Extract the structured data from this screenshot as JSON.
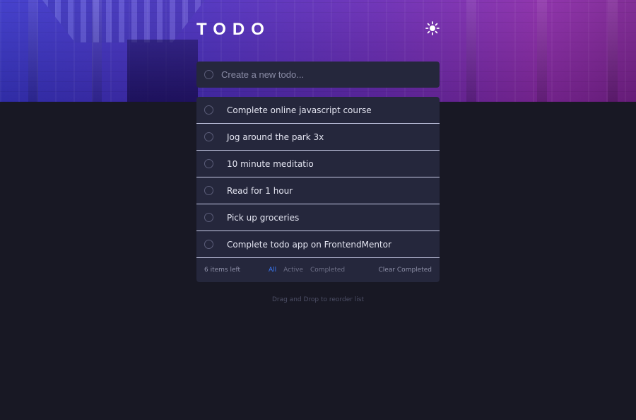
{
  "app": {
    "title": "TODO"
  },
  "colors": {
    "background": "#181824",
    "card": "#25273c",
    "accent": "#3a7bfd"
  },
  "header": {
    "theme_icon": "sun-icon"
  },
  "new_todo": {
    "placeholder": "Create a new todo..."
  },
  "todos": [
    {
      "text": "Complete online javascript course",
      "completed": false
    },
    {
      "text": "Jog around the park 3x",
      "completed": false
    },
    {
      "text": "10 minute meditatio",
      "completed": false
    },
    {
      "text": "Read for 1 hour",
      "completed": false
    },
    {
      "text": "Pick up groceries",
      "completed": false
    },
    {
      "text": "Complete todo app on FrontendMentor",
      "completed": false
    }
  ],
  "footer": {
    "items_left": "6 items left",
    "filters": [
      "All",
      "Active",
      "Completed"
    ],
    "active_filter": "All",
    "clear_label": "Clear Completed"
  },
  "hint": "Drag and Drop to reorder list"
}
